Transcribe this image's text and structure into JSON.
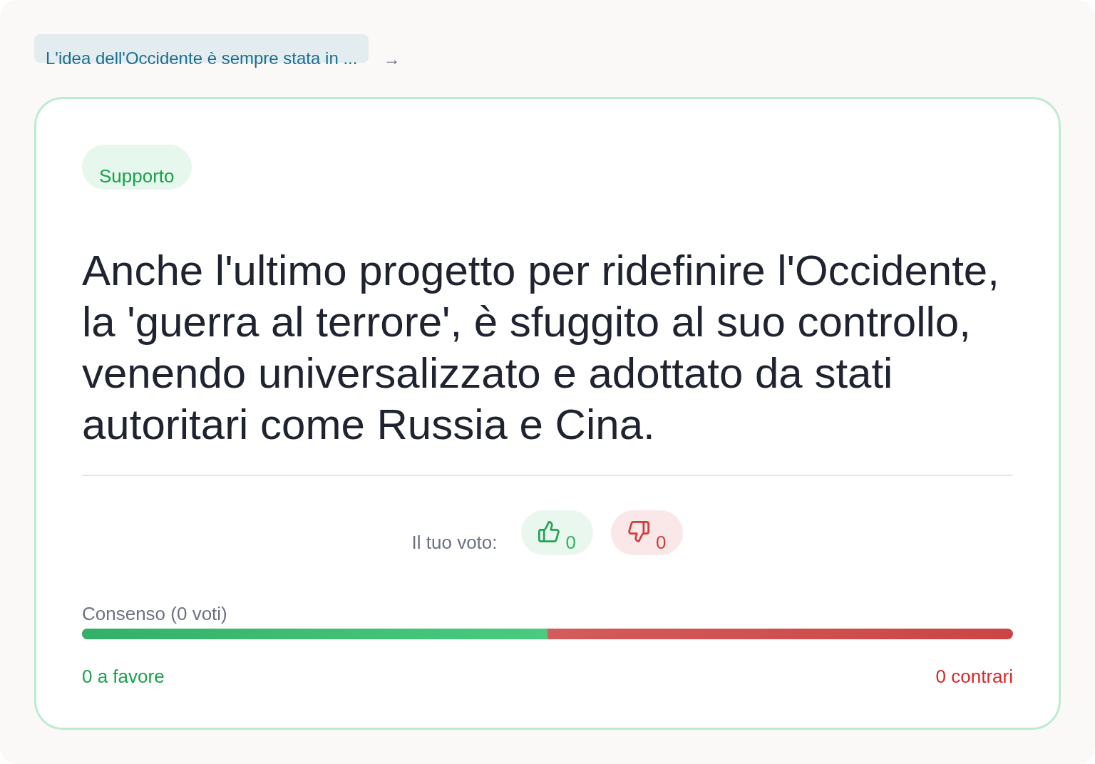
{
  "breadcrumb": {
    "label": "L'idea dell'Occidente è sempre stata in ...",
    "arrow": "→"
  },
  "card": {
    "stance": {
      "kind": "support",
      "label": "Supporto"
    },
    "claim": "Anche l'ultimo progetto per ridefinire l'Occidente, la 'guerra al terrore', è sfuggito al suo controllo, venendo universalizzato e adottato da stati autoritari come Russia e Cina.",
    "vote": {
      "label": "Il tuo voto:",
      "buttons": [
        {
          "kind": "up",
          "count": "0"
        },
        {
          "kind": "down",
          "count": "0"
        }
      ]
    },
    "consensus": {
      "label": "Consenso (0 voti)",
      "level": 0.5,
      "favor": "0 a favore",
      "against": "0 contrari"
    }
  }
}
